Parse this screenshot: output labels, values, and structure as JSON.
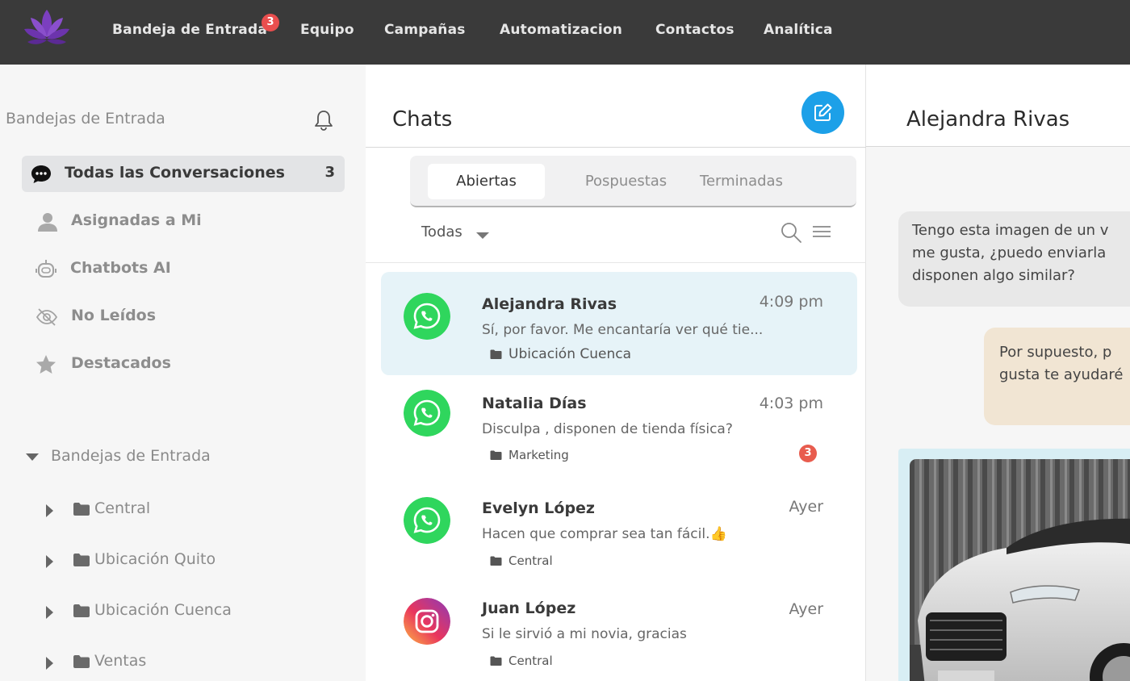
{
  "nav": {
    "items": [
      {
        "label": "Bandeja de Entrada",
        "badge": "3"
      },
      {
        "label": "Equipo"
      },
      {
        "label": "Campañas"
      },
      {
        "label": "Automatizacion"
      },
      {
        "label": "Contactos"
      },
      {
        "label": "Analítica"
      }
    ],
    "logo_icon": "lotus-logo-icon",
    "brand_color": "#7b3fbf"
  },
  "sidebar": {
    "title": "Bandejas de Entrada",
    "items": [
      {
        "label": "Todas las Conversaciones",
        "count": "3",
        "icon": "chat-bubble-icon"
      },
      {
        "label": "Asignadas a Mi",
        "icon": "user-icon"
      },
      {
        "label": "Chatbots AI",
        "icon": "robot-icon"
      },
      {
        "label": "No Leídos",
        "icon": "eye-off-icon"
      },
      {
        "label": "Destacados",
        "icon": "star-icon"
      }
    ],
    "section_label": "Bandejas de Entrada",
    "folders": [
      {
        "label": "Central"
      },
      {
        "label": "Ubicación Quito"
      },
      {
        "label": "Ubicación Cuenca"
      },
      {
        "label": "Ventas"
      }
    ]
  },
  "chatlist": {
    "title": "Chats",
    "tabs": [
      "Abiertas",
      "Pospuestas",
      "Terminadas"
    ],
    "filter": "Todas",
    "chats": [
      {
        "name": "Alejandra Rivas",
        "time": "4:09 pm",
        "message": "Sí, por favor. Me encantaría ver qué tie...",
        "tag": "Ubicación Cuenca",
        "channel": "whatsapp"
      },
      {
        "name": "Natalia Días",
        "time": "4:03 pm",
        "message": "Disculpa , disponen de tienda física?",
        "tag": "Marketing",
        "channel": "whatsapp",
        "badge": "3"
      },
      {
        "name": "Evelyn López",
        "time": "Ayer",
        "message": "Hacen que comprar sea tan fácil.👍",
        "tag": "Central",
        "channel": "whatsapp"
      },
      {
        "name": "Juan López",
        "time": "Ayer",
        "message": "Si le sirvió a mi novia, gracias",
        "tag": "Central",
        "channel": "instagram"
      }
    ]
  },
  "conversation": {
    "contact_name": "Alejandra Rivas",
    "incoming": {
      "line1": "Tengo esta imagen de un v",
      "line2": "me gusta, ¿puedo enviarla",
      "line3": "disponen algo similar?"
    },
    "outgoing": {
      "line1": "Por supuesto, p",
      "line2": "gusta te ayudaré"
    }
  },
  "colors": {
    "topbar": "#3a3a3a",
    "accent": "#1ca0e8",
    "whatsapp": "#2fd65d",
    "badge": "#e94e4e",
    "active_chat": "#e6f3f8"
  }
}
